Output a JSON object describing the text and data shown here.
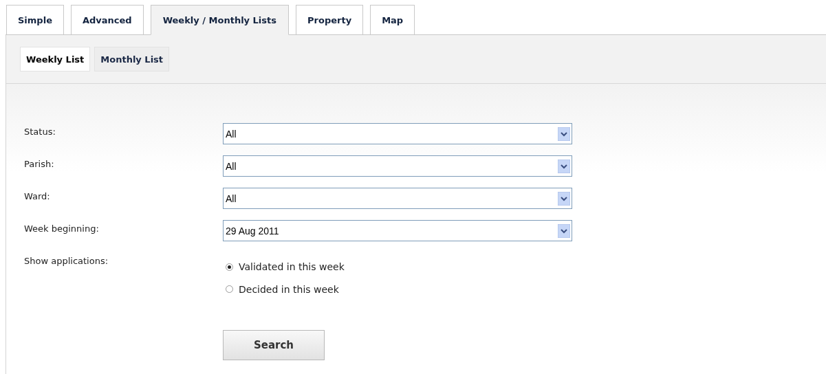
{
  "tabs": [
    {
      "label": "Simple",
      "selected": false
    },
    {
      "label": "Advanced",
      "selected": false
    },
    {
      "label": "Weekly / Monthly Lists",
      "selected": true
    },
    {
      "label": "Property",
      "selected": false
    },
    {
      "label": "Map",
      "selected": false
    }
  ],
  "subtabs": [
    {
      "label": "Weekly List",
      "selected": true
    },
    {
      "label": "Monthly List",
      "selected": false
    }
  ],
  "fields": [
    {
      "label": "Status:",
      "value": "All"
    },
    {
      "label": "Parish:",
      "value": "All"
    },
    {
      "label": "Ward:",
      "value": "All"
    },
    {
      "label": "Week beginning:",
      "value": "29 Aug 2011"
    }
  ],
  "show_applications": {
    "label": "Show applications:",
    "options": [
      {
        "label": "Validated in this week",
        "selected": true
      },
      {
        "label": "Decided in this week",
        "selected": false
      }
    ]
  },
  "search_button": "Search"
}
